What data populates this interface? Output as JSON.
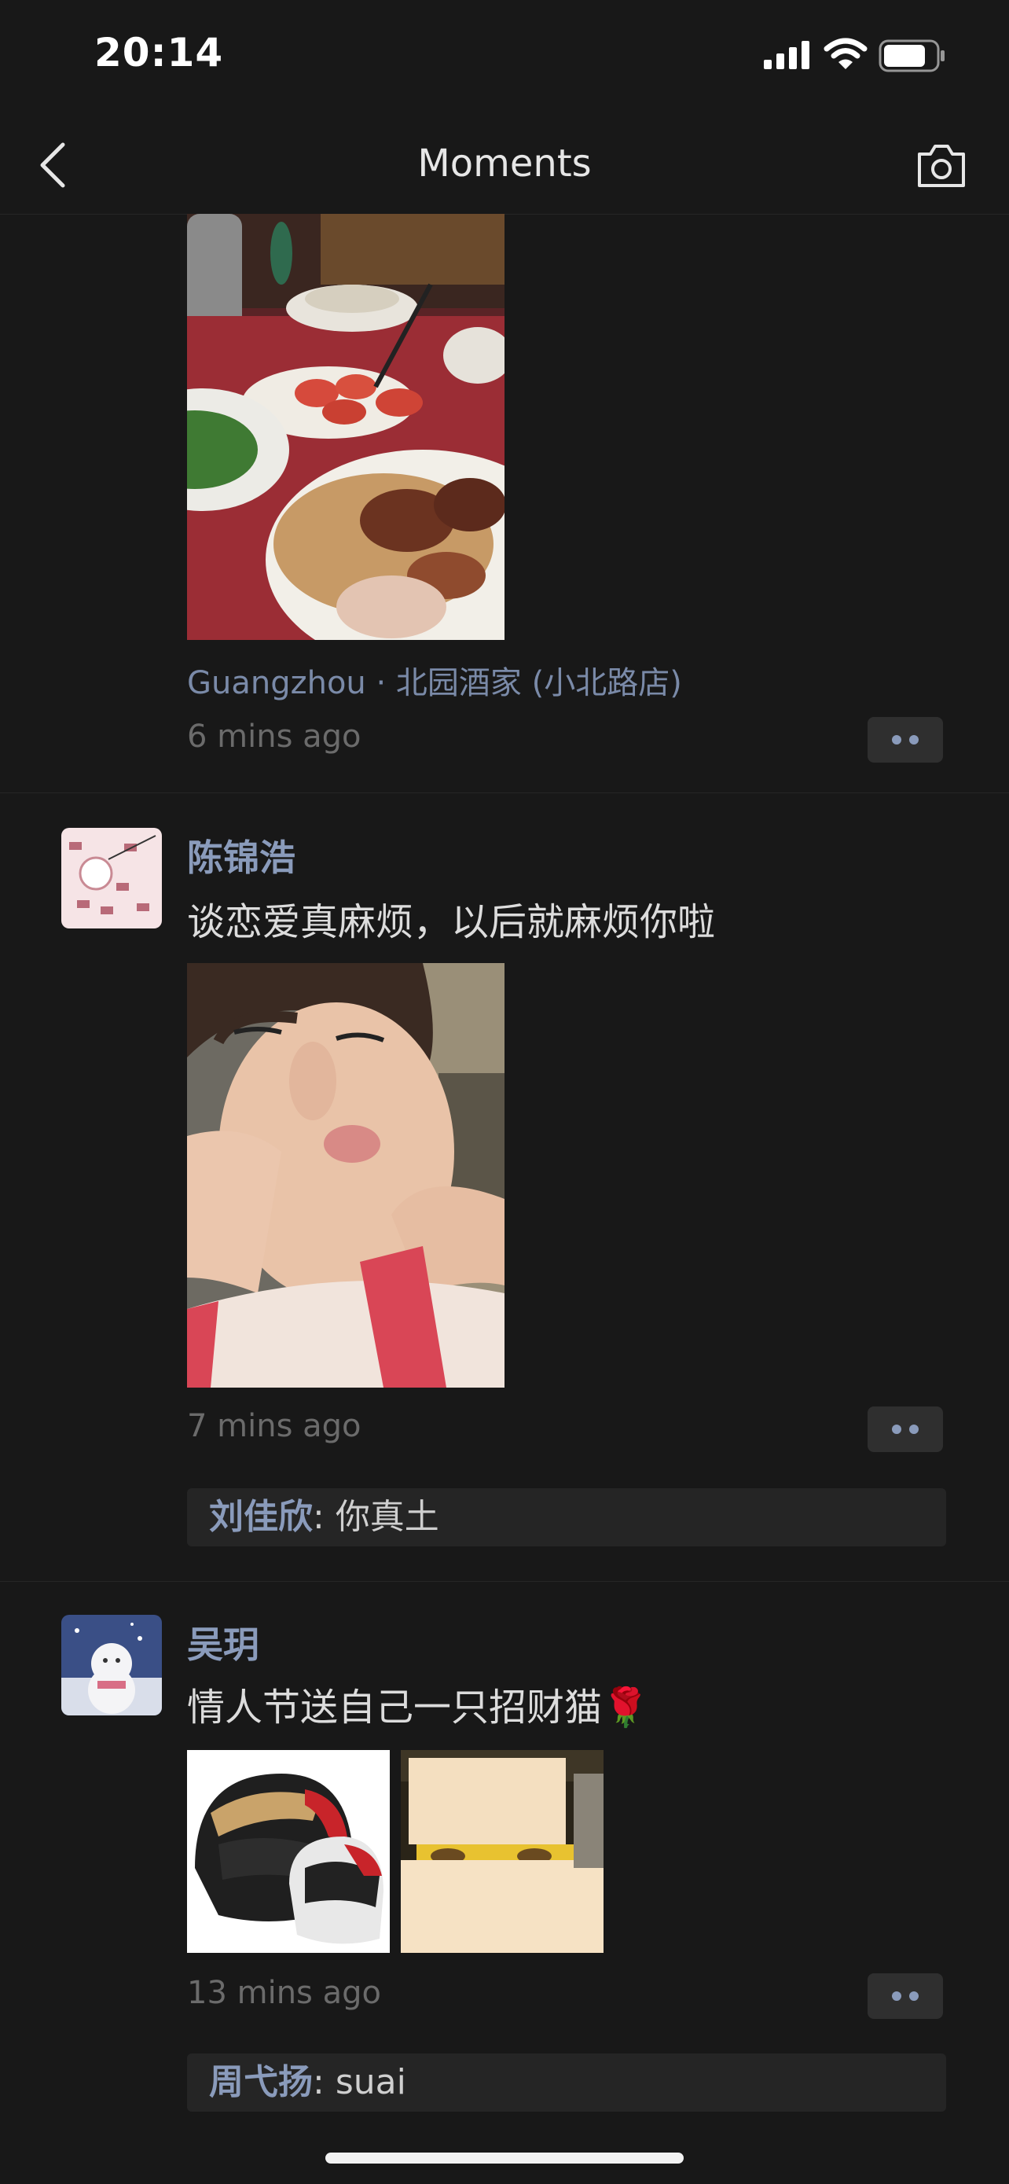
{
  "status_bar": {
    "time": "20:14"
  },
  "nav": {
    "title": "Moments"
  },
  "posts": [
    {
      "location": "Guangzhou · 北园酒家 (小北路店)",
      "time_ago": "6 mins ago"
    },
    {
      "author": "陈锦浩",
      "text": "谈恋爱真麻烦，以后就麻烦你啦",
      "time_ago": "7 mins ago",
      "comment": {
        "author": "刘佳欣",
        "separator": ": ",
        "text": "你真土"
      }
    },
    {
      "author": "吴玥",
      "text": "情人节送自己一只招财猫🌹",
      "time_ago": "13 mins ago",
      "comment": {
        "author": "周弋扬",
        "separator": ": ",
        "text": "suai"
      }
    }
  ],
  "colors": {
    "background": "#181818",
    "name": "#8a9bbb",
    "text": "#dcdcdc",
    "muted": "#6b6b6b"
  }
}
